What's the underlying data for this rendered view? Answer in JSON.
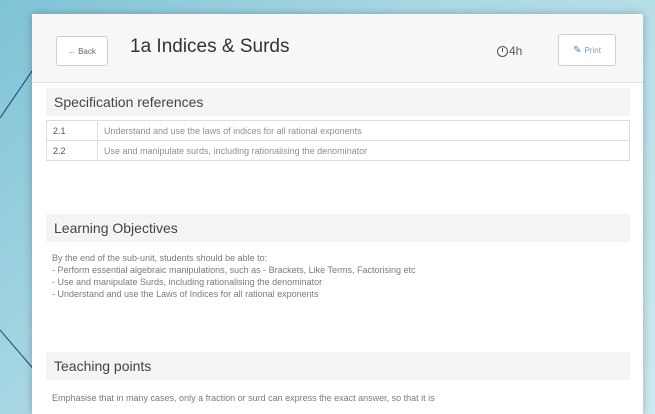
{
  "header": {
    "back_label": "Back",
    "title": "1a Indices & Surds",
    "duration": "4h",
    "print_label": "Print"
  },
  "spec": {
    "heading": "Specification references",
    "rows": [
      {
        "ref": "2.1",
        "text": "Understand and use the laws of indices for all rational exponents"
      },
      {
        "ref": "2.2",
        "text": "Use and manipulate surds, including rationalising the denominator"
      }
    ]
  },
  "objectives": {
    "heading": "Learning Objectives",
    "intro": "By the end of the sub-unit, students should be able to:",
    "items": [
      "- Perform essential algebraic manipulations, such as - Brackets, Like Terms, Factorising etc",
      "- Use and manipulate Surds, including rationalising the denominator",
      "- Understand and use the Laws of Indices for all rational exponents"
    ]
  },
  "teaching": {
    "heading": "Teaching points",
    "text": "Emphasise that in many cases, only a fraction or surd can express the exact answer, so that it is"
  }
}
